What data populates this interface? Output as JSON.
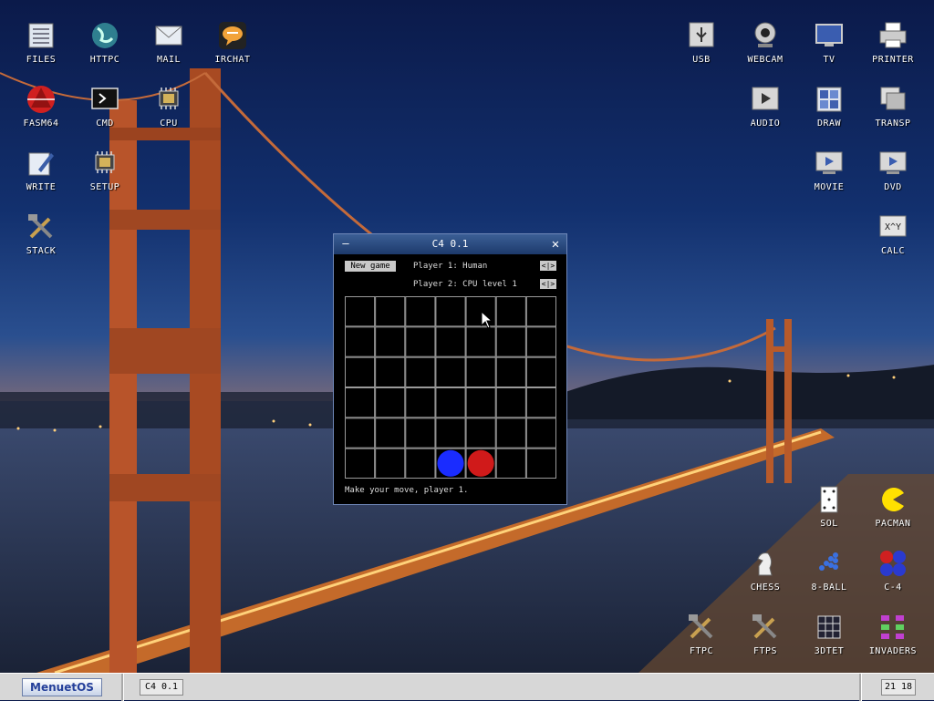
{
  "desktop_icons": {
    "files": {
      "label": "FILES",
      "icon": "files-icon"
    },
    "httpc": {
      "label": "HTTPC",
      "icon": "globe-icon"
    },
    "mail": {
      "label": "MAIL",
      "icon": "mail-icon"
    },
    "irchat": {
      "label": "IRCHAT",
      "icon": "chat-icon"
    },
    "fasm64": {
      "label": "FASM64",
      "icon": "fasm-icon"
    },
    "cmd": {
      "label": "CMD",
      "icon": "terminal-icon"
    },
    "cpu": {
      "label": "CPU",
      "icon": "chip-icon"
    },
    "write": {
      "label": "WRITE",
      "icon": "pen-icon"
    },
    "setup": {
      "label": "SETUP",
      "icon": "chip-icon"
    },
    "stack": {
      "label": "STACK",
      "icon": "tools-icon"
    },
    "usb": {
      "label": "USB",
      "icon": "usb-icon"
    },
    "webcam": {
      "label": "WEBCAM",
      "icon": "webcam-icon"
    },
    "tv": {
      "label": "TV",
      "icon": "tv-icon"
    },
    "printer": {
      "label": "PRINTER",
      "icon": "printer-icon"
    },
    "audio": {
      "label": "AUDIO",
      "icon": "play-icon"
    },
    "draw": {
      "label": "DRAW",
      "icon": "grid-icon"
    },
    "transp": {
      "label": "TRANSP",
      "icon": "window-icon"
    },
    "movie": {
      "label": "MOVIE",
      "icon": "movie-icon"
    },
    "dvd": {
      "label": "DVD",
      "icon": "movie-icon"
    },
    "calc": {
      "label": "CALC",
      "icon": "calc-icon"
    },
    "sol": {
      "label": "SOL",
      "icon": "card-icon"
    },
    "pacman": {
      "label": "PACMAN",
      "icon": "pacman-icon"
    },
    "chess": {
      "label": "CHESS",
      "icon": "chess-knight-icon"
    },
    "eightball": {
      "label": "8-BALL",
      "icon": "balls-icon"
    },
    "c4": {
      "label": "C-4",
      "icon": "c4-icon"
    },
    "ftpc": {
      "label": "FTPC",
      "icon": "tools-icon"
    },
    "ftps": {
      "label": "FTPS",
      "icon": "tools-icon"
    },
    "threedtet": {
      "label": "3DTET",
      "icon": "cube-icon"
    },
    "invaders": {
      "label": "INVADERS",
      "icon": "invader-icon"
    }
  },
  "window": {
    "title": "C4 0.1",
    "new_game_label": "New game",
    "player1": "Player 1: Human",
    "player2": "Player 2: CPU level 1",
    "arrows": "<|>",
    "status": "Make your move, player 1.",
    "board": {
      "columns": 7,
      "rows": 6,
      "pieces": [
        {
          "row": 6,
          "col": 4,
          "color": "blue"
        },
        {
          "row": 6,
          "col": 5,
          "color": "red"
        }
      ]
    }
  },
  "taskbar": {
    "os_label": "MenuetOS",
    "task_label": "C4 0.1",
    "clock": "21 18"
  },
  "colors": {
    "piece_blue": "#1a2cff",
    "piece_red": "#d01a1a",
    "title_bar": "#2b4c85"
  }
}
